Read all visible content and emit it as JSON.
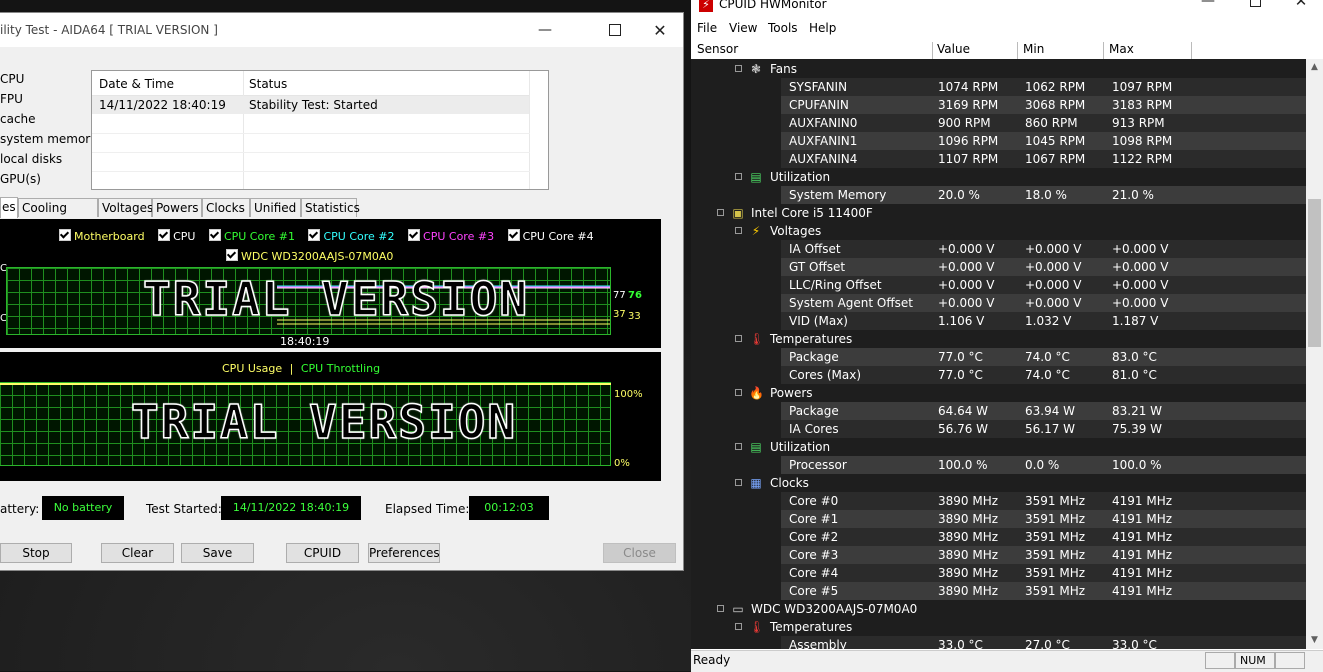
{
  "aida": {
    "title": "ility Test - AIDA64  [ TRIAL VERSION ]",
    "stress_items": [
      "CPU",
      "FPU",
      "cache",
      "system memory",
      "local disks",
      "GPU(s)"
    ],
    "log": {
      "headers": [
        "Date & Time",
        "Status"
      ],
      "rows": [
        [
          "14/11/2022 18:40:19",
          "Stability Test: Started"
        ]
      ]
    },
    "tabs": [
      "es",
      "Cooling Fans",
      "Voltages",
      "Powers",
      "Clocks",
      "Unified",
      "Statistics"
    ],
    "temp_graph": {
      "legend": [
        {
          "label": "Motherboard",
          "color": "#ffff66"
        },
        {
          "label": "CPU",
          "color": "#ffffff"
        },
        {
          "label": "CPU Core #1",
          "color": "#33ff33"
        },
        {
          "label": "CPU Core #2",
          "color": "#33ffff"
        },
        {
          "label": "CPU Core #3",
          "color": "#ff44ff"
        },
        {
          "label": "CPU Core #4",
          "color": "#ffffff"
        }
      ],
      "legend2": {
        "label": "WDC WD3200AAJS-07M0A0",
        "color": "#ffff66"
      },
      "watermark": "TRIAL VERSION",
      "time_label": "18:40:19",
      "readout_top_a": "77",
      "readout_top_b": "76",
      "readout_bot_a": "37",
      "readout_bot_b": "33",
      "axis_top": "C",
      "axis_bot": "C"
    },
    "usage_graph": {
      "label1": "CPU Usage",
      "sep": "|",
      "label2": "CPU Throttling",
      "watermark": "TRIAL VERSION",
      "max_label": "100%",
      "min_label": "0%"
    },
    "battery_label": "attery:",
    "battery_value": "No battery",
    "test_started_label": "Test Started:",
    "test_started_value": "14/11/2022 18:40:19",
    "elapsed_label": "Elapsed Time:",
    "elapsed_value": "00:12:03",
    "buttons": {
      "stop": "Stop",
      "clear": "Clear",
      "save": "Save",
      "cpuid": "CPUID",
      "preferences": "Preferences",
      "close": "Close"
    }
  },
  "hwm": {
    "title": "CPUID HWMonitor",
    "menu": [
      "File",
      "View",
      "Tools",
      "Help"
    ],
    "columns": [
      "Sensor",
      "Value",
      "Min",
      "Max"
    ],
    "rows": [
      {
        "type": "group",
        "level": 2,
        "icon": "fan",
        "label": "Fans"
      },
      {
        "type": "data",
        "label": "SYSFANIN",
        "value": "1074 RPM",
        "min": "1062 RPM",
        "max": "1097 RPM"
      },
      {
        "type": "data",
        "label": "CPUFANIN",
        "value": "3169 RPM",
        "min": "3068 RPM",
        "max": "3183 RPM"
      },
      {
        "type": "data",
        "label": "AUXFANIN0",
        "value": "900 RPM",
        "min": "860 RPM",
        "max": "913 RPM"
      },
      {
        "type": "data",
        "label": "AUXFANIN1",
        "value": "1096 RPM",
        "min": "1045 RPM",
        "max": "1098 RPM"
      },
      {
        "type": "data",
        "label": "AUXFANIN4",
        "value": "1107 RPM",
        "min": "1067 RPM",
        "max": "1122 RPM"
      },
      {
        "type": "group",
        "level": 2,
        "icon": "util",
        "label": "Utilization"
      },
      {
        "type": "data",
        "label": "System Memory",
        "value": "20.0 %",
        "min": "18.0 %",
        "max": "21.0 %"
      },
      {
        "type": "group",
        "level": 1,
        "icon": "chip",
        "label": "Intel Core i5 11400F"
      },
      {
        "type": "group",
        "level": 2,
        "icon": "volt",
        "label": "Voltages"
      },
      {
        "type": "data",
        "label": "IA Offset",
        "value": "+0.000 V",
        "min": "+0.000 V",
        "max": "+0.000 V"
      },
      {
        "type": "data",
        "label": "GT Offset",
        "value": "+0.000 V",
        "min": "+0.000 V",
        "max": "+0.000 V"
      },
      {
        "type": "data",
        "label": "LLC/Ring Offset",
        "value": "+0.000 V",
        "min": "+0.000 V",
        "max": "+0.000 V"
      },
      {
        "type": "data",
        "label": "System Agent Offset",
        "value": "+0.000 V",
        "min": "+0.000 V",
        "max": "+0.000 V"
      },
      {
        "type": "data",
        "label": "VID (Max)",
        "value": "1.106 V",
        "min": "1.032 V",
        "max": "1.187 V"
      },
      {
        "type": "group",
        "level": 2,
        "icon": "temp",
        "label": "Temperatures"
      },
      {
        "type": "data",
        "label": "Package",
        "value": "77.0 °C",
        "min": "74.0 °C",
        "max": "83.0 °C"
      },
      {
        "type": "data",
        "label": "Cores (Max)",
        "value": "77.0 °C",
        "min": "74.0 °C",
        "max": "81.0 °C"
      },
      {
        "type": "group",
        "level": 2,
        "icon": "power",
        "label": "Powers"
      },
      {
        "type": "data",
        "label": "Package",
        "value": "64.64 W",
        "min": "63.94 W",
        "max": "83.21 W"
      },
      {
        "type": "data",
        "label": "IA Cores",
        "value": "56.76 W",
        "min": "56.17 W",
        "max": "75.39 W"
      },
      {
        "type": "group",
        "level": 2,
        "icon": "util",
        "label": "Utilization"
      },
      {
        "type": "data",
        "label": "Processor",
        "value": "100.0 %",
        "min": "0.0 %",
        "max": "100.0 %"
      },
      {
        "type": "group",
        "level": 2,
        "icon": "clock",
        "label": "Clocks"
      },
      {
        "type": "data",
        "label": "Core #0",
        "value": "3890 MHz",
        "min": "3591 MHz",
        "max": "4191 MHz"
      },
      {
        "type": "data",
        "label": "Core #1",
        "value": "3890 MHz",
        "min": "3591 MHz",
        "max": "4191 MHz"
      },
      {
        "type": "data",
        "label": "Core #2",
        "value": "3890 MHz",
        "min": "3591 MHz",
        "max": "4191 MHz"
      },
      {
        "type": "data",
        "label": "Core #3",
        "value": "3890 MHz",
        "min": "3591 MHz",
        "max": "4191 MHz"
      },
      {
        "type": "data",
        "label": "Core #4",
        "value": "3890 MHz",
        "min": "3591 MHz",
        "max": "4191 MHz"
      },
      {
        "type": "data",
        "label": "Core #5",
        "value": "3890 MHz",
        "min": "3591 MHz",
        "max": "4191 MHz"
      },
      {
        "type": "group",
        "level": 1,
        "icon": "disk",
        "label": "WDC WD3200AAJS-07M0A0"
      },
      {
        "type": "group",
        "level": 2,
        "icon": "temp",
        "label": "Temperatures"
      },
      {
        "type": "data",
        "label": "Assembly",
        "value": "33.0 °C",
        "min": "27.0 °C",
        "max": "33.0 °C"
      }
    ],
    "status": "Ready",
    "num": "NUM"
  }
}
